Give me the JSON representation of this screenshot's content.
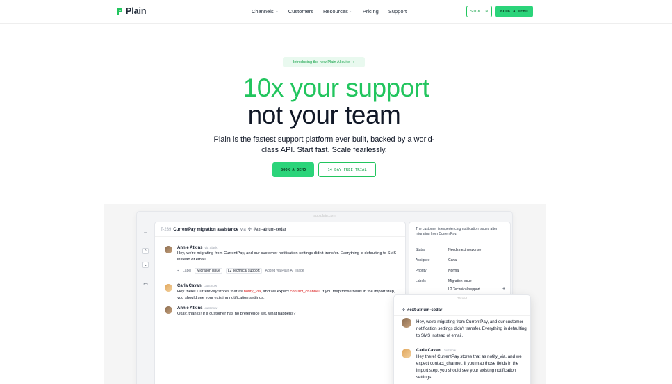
{
  "nav": {
    "brand": "Plain",
    "links": [
      {
        "label": "Channels",
        "has_menu": true
      },
      {
        "label": "Customers",
        "has_menu": false
      },
      {
        "label": "Resources",
        "has_menu": true
      },
      {
        "label": "Pricing",
        "has_menu": false
      },
      {
        "label": "Support",
        "has_menu": false
      }
    ],
    "sign_in": "SIGN IN",
    "book_demo": "BOOK A DEMO"
  },
  "hero": {
    "announcement": "Introducing the new Plain AI suite",
    "announcement_arrow": "›",
    "headline_1": "10x your support",
    "headline_2": "not your team",
    "subtitle": "Plain is the fastest support platform ever built, backed by a world-class API. Start fast. Scale fearlessly.",
    "cta_primary": "BOOK A DEMO",
    "cta_secondary": "14 DAY FREE TRIAL"
  },
  "colors": {
    "brand_green": "#2bd47a",
    "headline_green": "#22c55e",
    "text_dark": "#111827"
  },
  "app": {
    "url_bar": "app.plain.com",
    "thread": {
      "id": "T-239",
      "title": "CurrentPay migration assistance",
      "via": "via",
      "customer": "#ext-atrium-cedar"
    },
    "messages": [
      {
        "name": "Annie Atkins",
        "time": "via Slack",
        "text": "Hey, we're migrating from CurrentPay, and our customer notification settings didn't transfer. Everything is defaulting to SMS instead of email.",
        "tags": {
          "label": "Label",
          "tag1": "Migration issue",
          "tag2": "L2 Technical support",
          "note": "Added via Plain AI Triage"
        }
      },
      {
        "name": "Carla Cavani",
        "time": "Just now",
        "text_a": "Hey there! CurrentPay stores that as ",
        "code_a": "notify_via",
        "text_b": ", and we expect ",
        "code_b": "contact_channel",
        "text_c": ". If you map those fields in the import step, you should see your existing notification settings."
      },
      {
        "name": "Annie Atkins",
        "time": "Just now",
        "text": "Okay, thanks! If a customer has no preference set, what happens?"
      }
    ],
    "side": {
      "description": "The customer is experiencing notification issues after migrating from CurrentPay.",
      "fields": [
        {
          "key": "Status",
          "value": "Needs next response"
        },
        {
          "key": "Assignee",
          "value": "Carla"
        },
        {
          "key": "Priority",
          "value": "Normal"
        },
        {
          "key": "Labels",
          "value": "Migration issue"
        },
        {
          "key": "",
          "value": "L2 Technical support"
        }
      ]
    },
    "popout": {
      "top_label": "Thread",
      "channel": "#ext-atrium-cedar",
      "messages": [
        {
          "name": "",
          "time": "",
          "text": "Hey, we're migrating from CurrentPay, and our customer notification settings didn't transfer. Everything is defaulting to SMS instead of email."
        },
        {
          "name": "Carla Cavani",
          "time": "Just now",
          "text": "Hey there! CurrentPay stores that as notify_via, and we expect contact_channel. If you map those fields in the import step, you should see your existing notification settings."
        }
      ]
    }
  }
}
